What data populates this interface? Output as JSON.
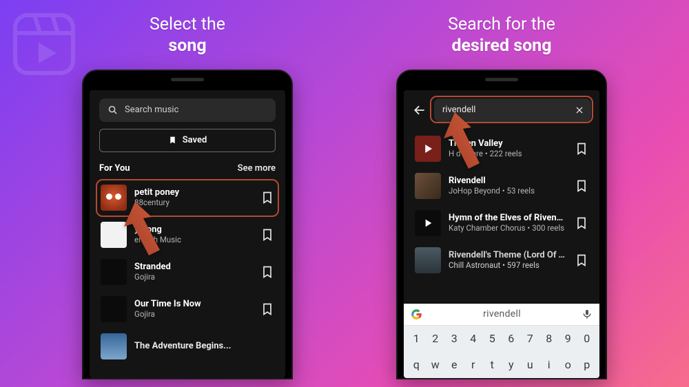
{
  "captions": {
    "left_line1": "Select the",
    "left_line2": "song",
    "right_line1": "Search for the",
    "right_line2": "desired song"
  },
  "left": {
    "search_placeholder": "Search music",
    "saved_label": "Saved",
    "section_title": "For You",
    "see_more": "See more",
    "songs": [
      {
        "title": "petit poney",
        "subtitle": "88century"
      },
      {
        "title": "y Song",
        "subtitle": "endish Music"
      },
      {
        "title": "Stranded",
        "subtitle": "Gojira"
      },
      {
        "title": "Our Time Is Now",
        "subtitle": "Gojira"
      },
      {
        "title": "The Adventure Begins...",
        "subtitle": ""
      }
    ]
  },
  "right": {
    "search_value": "rivendell",
    "suggestion": "rivendell",
    "songs": [
      {
        "title": "The           en Valley",
        "subtitle": "H         d Shore • 222 reels"
      },
      {
        "title": "Rivendell",
        "subtitle": "JoHop Beyond • 53 reels"
      },
      {
        "title": "Hymn of the Elves of Rivendell",
        "subtitle": "Katy Chamber Chorus • 300 reels"
      },
      {
        "title": "Rivendell's Theme (Lord Of The R…",
        "subtitle": "Chill Astronaut • 597 reels"
      }
    ],
    "num_row": [
      "1",
      "2",
      "3",
      "4",
      "5",
      "6",
      "7",
      "8",
      "9",
      "0"
    ],
    "letter_row": [
      "q",
      "w",
      "e",
      "r",
      "t",
      "y",
      "u",
      "i",
      "o",
      "p"
    ]
  }
}
